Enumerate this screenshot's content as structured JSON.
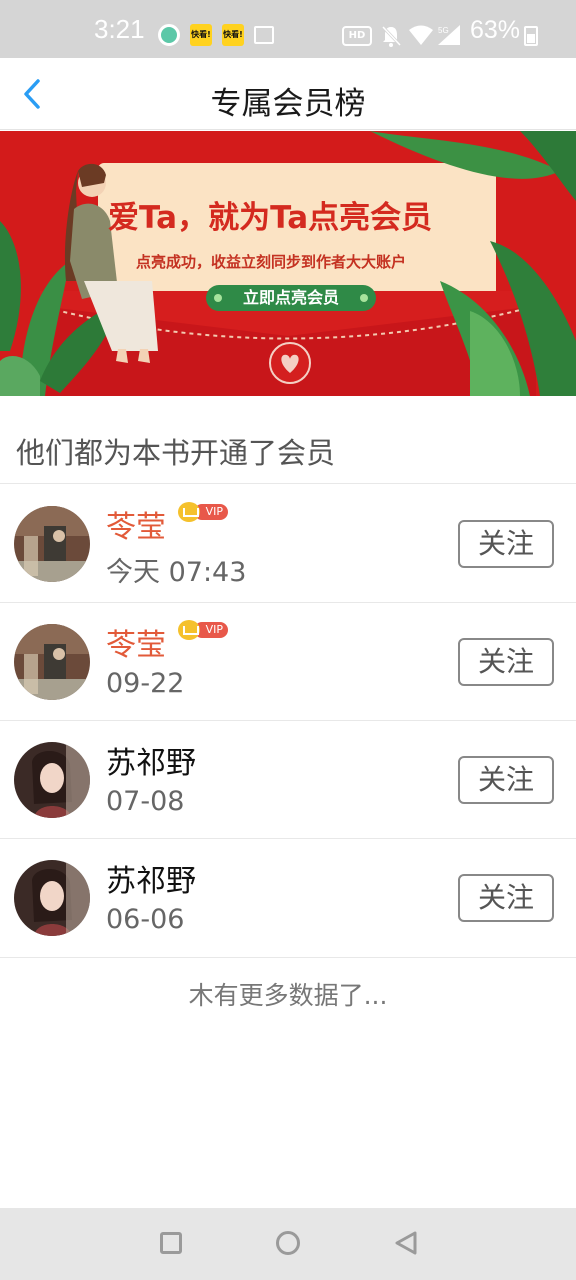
{
  "status_bar": {
    "time": "3:21",
    "notification_label": "快看!",
    "hd_label": "HD",
    "battery_percent": "63%"
  },
  "header": {
    "title": "专属会员榜"
  },
  "banner": {
    "headline": "爱Ta，就为Ta点亮会员",
    "subtitle": "点亮成功，收益立刻同步到作者大大账户",
    "button_label": "立即点亮会员"
  },
  "section": {
    "title": "他们都为本书开通了会员"
  },
  "members": [
    {
      "name": "苓莹",
      "vip": true,
      "vip_label": "VIP",
      "time": "今天 07:43",
      "follow_label": "关注"
    },
    {
      "name": "苓莹",
      "vip": true,
      "vip_label": "VIP",
      "time": "09-22",
      "follow_label": "关注"
    },
    {
      "name": "苏祁野",
      "vip": false,
      "time": "07-08",
      "follow_label": "关注"
    },
    {
      "name": "苏祁野",
      "vip": false,
      "time": "06-06",
      "follow_label": "关注"
    }
  ],
  "footer": {
    "no_more": "木有更多数据了..."
  },
  "colors": {
    "accent_blue": "#2a9df4",
    "vip_name": "#e25a39",
    "banner_red": "#d21a1a",
    "banner_button_green": "#2f8a47"
  }
}
